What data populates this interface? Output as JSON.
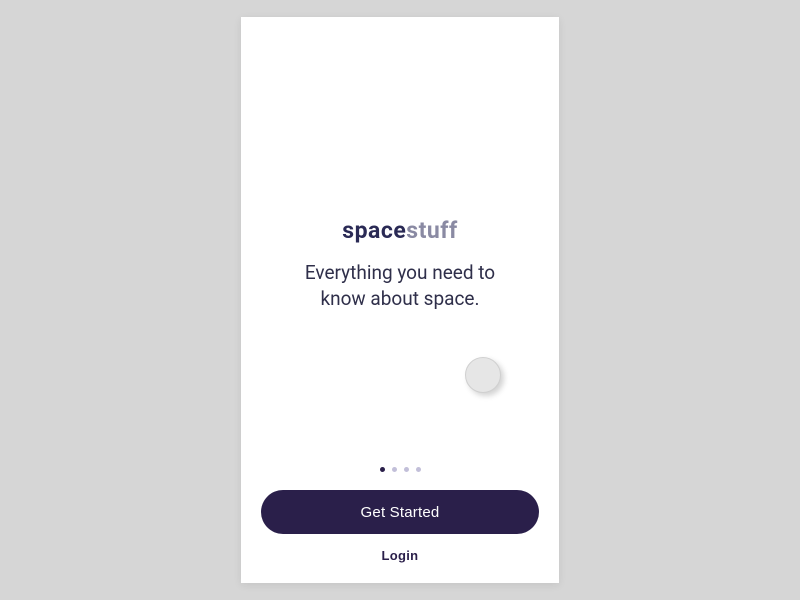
{
  "brand": {
    "prefix": "space",
    "suffix": "stuff"
  },
  "tagline": "Everything you need to know about space.",
  "pagination": {
    "total": 4,
    "active": 0
  },
  "buttons": {
    "primary": "Get Started",
    "login": "Login"
  },
  "colors": {
    "brandDark": "#2a1f4a",
    "brandLight": "#8a8aa3",
    "dotInactive": "#c2bfd9",
    "background": "#d6d6d6"
  }
}
